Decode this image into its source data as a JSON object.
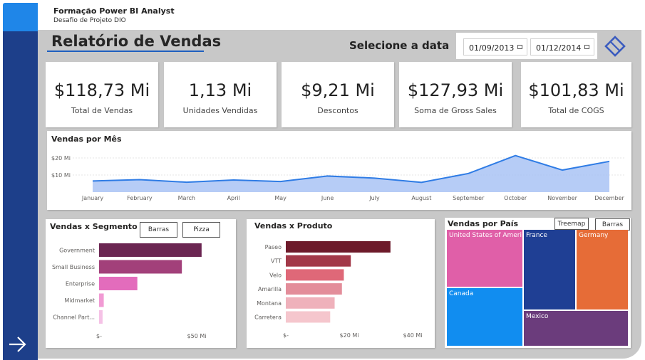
{
  "app": {
    "title": "Formação Power BI Analyst",
    "subtitle": "Desafio de Projeto DIO"
  },
  "report": {
    "title": "Relatório de Vendas",
    "date_label": "Selecione a data"
  },
  "date_filter": {
    "start": "01/09/2013",
    "end": "01/12/2014"
  },
  "kpis": [
    {
      "value": "$118,73 Mi",
      "label": "Total de Vendas"
    },
    {
      "value": "1,13 Mi",
      "label": "Unidades Vendidas"
    },
    {
      "value": "$9,21 Mi",
      "label": "Descontos"
    },
    {
      "value": "$127,93 Mi",
      "label": "Soma de Gross Sales"
    },
    {
      "value": "$101,83 Mi",
      "label": "Total de COGS"
    }
  ],
  "buttons": {
    "barras": "Barras",
    "pizza": "Pizza",
    "treemap": "Treemap",
    "barras2": "Barras"
  },
  "colors": {
    "nav": "#1d3f8a",
    "accent": "#1f86e8",
    "line": "#2f7ce5",
    "area": "#a9c3f5"
  },
  "icons": {
    "nav_arrow": "arrow-right-icon",
    "calendar": "calendar-icon",
    "eraser": "eraser-icon"
  },
  "chart_data": [
    {
      "type": "area",
      "title": "Vendas por Mês",
      "categories": [
        "January",
        "February",
        "March",
        "April",
        "May",
        "June",
        "July",
        "August",
        "September",
        "October",
        "November",
        "December"
      ],
      "values": [
        6.5,
        7.3,
        5.8,
        7.1,
        6.2,
        9.4,
        8.2,
        5.7,
        10.9,
        21.4,
        12.9,
        18.0
      ],
      "y_ticks": [
        "$10 Mi",
        "$20 Mi"
      ],
      "ylim": [
        0,
        25
      ],
      "grid": true
    },
    {
      "type": "bar",
      "orientation": "horizontal",
      "title": "Vendas x Segmento",
      "categories": [
        "Government",
        "Small Business",
        "Enterprise",
        "Midmarket",
        "Channel Part..."
      ],
      "values": [
        52.5,
        42.4,
        19.6,
        2.4,
        1.8
      ],
      "colors": [
        "#6b2652",
        "#a2407a",
        "#e36cbc",
        "#f19ad4",
        "#f5c2e6"
      ],
      "x_ticks": [
        "$-",
        "$50 Mi"
      ],
      "xlim": [
        0,
        50
      ]
    },
    {
      "type": "bar",
      "orientation": "horizontal",
      "title": "Vendas x Produto",
      "categories": [
        "Paseo",
        "VTT",
        "Velo",
        "Amarilla",
        "Montana",
        "Carretera"
      ],
      "values": [
        33.0,
        20.5,
        18.3,
        17.7,
        15.4,
        14.0
      ],
      "colors": [
        "#6d1a2a",
        "#a23848",
        "#df6878",
        "#e38d9a",
        "#efb1bb",
        "#f5c6cd"
      ],
      "x_ticks": [
        "$-",
        "$20 Mi",
        "$40 Mi"
      ],
      "xlim": [
        0,
        40
      ]
    },
    {
      "type": "treemap",
      "title": "Vendas por País",
      "categories": [
        "United States of Ameri...",
        "Canada",
        "France",
        "Germany",
        "Mexico"
      ],
      "values": [
        25.03,
        24.89,
        24.35,
        23.51,
        20.95
      ],
      "colors": [
        "#e05fa8",
        "#118df0",
        "#1f3f94",
        "#e66c37",
        "#6b3c7c"
      ]
    }
  ]
}
